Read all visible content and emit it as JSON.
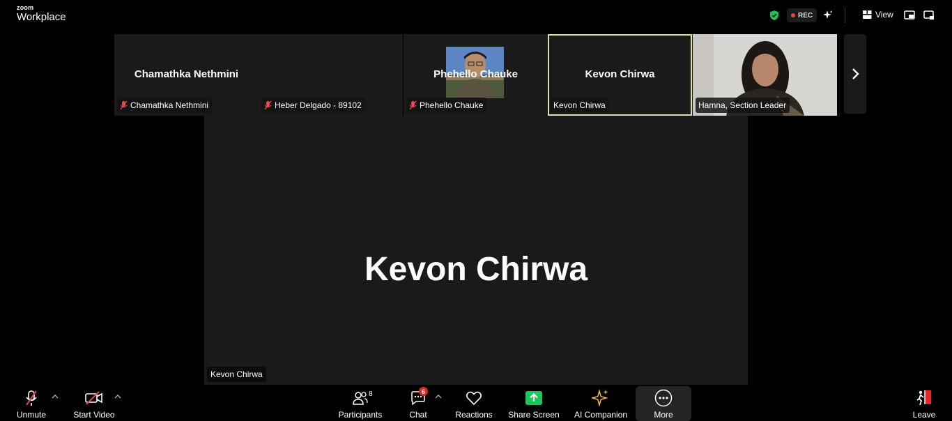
{
  "app": {
    "logo_top": "zoom",
    "logo_bottom": "Workplace"
  },
  "topbar": {
    "rec_label": "REC",
    "view_label": "View",
    "icons": [
      "shield-check-icon",
      "sparkle-icon",
      "view-grid-icon",
      "picture-in-picture-icon",
      "minimize-icon"
    ]
  },
  "thumbnails": [
    {
      "name": "Chamathka Nethmini",
      "label": "Chamathka Nethmini",
      "muted": true,
      "video": false
    },
    {
      "name": "",
      "label": "Heber Delgado - 89102",
      "muted": true,
      "video": true
    },
    {
      "name": "Phehello Chauke",
      "label": "Phehello Chauke",
      "muted": true,
      "video": false
    },
    {
      "name": "Kevon Chirwa",
      "label": "Kevon Chirwa",
      "muted": false,
      "video": false,
      "active": true
    },
    {
      "name": "",
      "label": "Hamna, Section Leader",
      "muted": false,
      "video": true
    }
  ],
  "main_speaker": {
    "name": "Kevon Chirwa",
    "label": "Kevon Chirwa"
  },
  "toolbar": {
    "unmute": "Unmute",
    "start_video": "Start Video",
    "participants": "Participants",
    "participants_count": "8",
    "chat": "Chat",
    "chat_badge": "6",
    "reactions": "Reactions",
    "share_screen": "Share Screen",
    "ai_companion": "AI Companion",
    "more": "More",
    "leave": "Leave"
  },
  "colors": {
    "accent_green": "#1fc55a",
    "active_border": "#d6e7a6",
    "muted_red": "#e5484d",
    "ai_gold": "#f5c542",
    "leave_red": "#e02828"
  }
}
